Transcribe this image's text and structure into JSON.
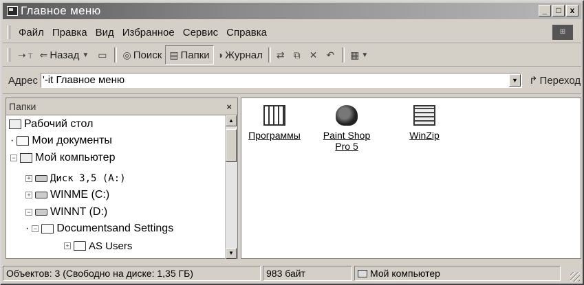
{
  "window": {
    "title": "Главное меню",
    "controls": [
      "_",
      "□",
      "x"
    ]
  },
  "menubar": {
    "items": [
      "Файл",
      "Правка",
      "Вид",
      "Избранное",
      "Сервис",
      "Справка"
    ]
  },
  "toolbar": {
    "forward_label": "т",
    "back_label": "Назад",
    "search_label": "Поиск",
    "folders_label": "Папки",
    "history_label": "Журнал"
  },
  "address": {
    "label": "Адрес",
    "value": "'-it Главное меню",
    "go_label": "Переход"
  },
  "folders_pane": {
    "title": "Папки",
    "tree": [
      {
        "label": "Рабочий стол"
      },
      {
        "label": "Мои документы"
      },
      {
        "label": "Мой компьютер"
      },
      {
        "label": "Диск 3,5 (A:)"
      },
      {
        "label": "WINME (C:)"
      },
      {
        "label": "WINNT (D:)"
      },
      {
        "label": "Documentsand Settings"
      },
      {
        "label": "AS Users"
      }
    ]
  },
  "content": {
    "items": [
      {
        "label": "Программы",
        "icon": "calendar-folder-icon"
      },
      {
        "label_line1": "Paint Shop",
        "label_line2": "Pro 5",
        "icon": "palette-icon"
      },
      {
        "label": "WinZip",
        "icon": "winzip-icon"
      }
    ]
  },
  "statusbar": {
    "objects": "Объектов: 3 (Свободно на диске: 1,35 ГБ)",
    "size": "983 байт",
    "location": "Мой компьютер"
  }
}
